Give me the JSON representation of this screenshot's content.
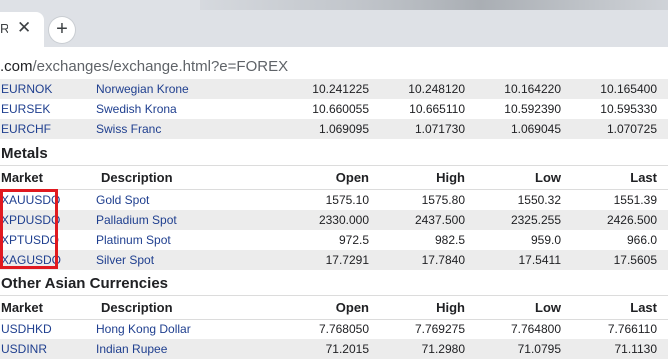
{
  "browser": {
    "tab_title": "R",
    "close_glyph": "✕",
    "new_tab_glyph": "+",
    "url_host": ".com",
    "url_path": "/exchanges/exchange.html?e=FOREX"
  },
  "columns": {
    "market": "Market",
    "description": "Description",
    "open": "Open",
    "high": "High",
    "low": "Low",
    "last": "Last"
  },
  "forex_rows": [
    {
      "market": "EURNOK",
      "description": "Norwegian Krone",
      "open": "10.241225",
      "high": "10.248120",
      "low": "10.164220",
      "last": "10.165400"
    },
    {
      "market": "EURSEK",
      "description": "Swedish Krona",
      "open": "10.660055",
      "high": "10.665110",
      "low": "10.592390",
      "last": "10.595330"
    },
    {
      "market": "EURCHF",
      "description": "Swiss Franc",
      "open": "1.069095",
      "high": "1.071730",
      "low": "1.069045",
      "last": "1.070725"
    }
  ],
  "metals": {
    "title": "Metals",
    "rows": [
      {
        "market": "XAUUSDO",
        "description": "Gold Spot",
        "open": "1575.10",
        "high": "1575.80",
        "low": "1550.32",
        "last": "1551.39"
      },
      {
        "market": "XPDUSDO",
        "description": "Palladium Spot",
        "open": "2330.000",
        "high": "2437.500",
        "low": "2325.255",
        "last": "2426.500"
      },
      {
        "market": "XPTUSDO",
        "description": "Platinum Spot",
        "open": "972.5",
        "high": "982.5",
        "low": "959.0",
        "last": "966.0"
      },
      {
        "market": "XAGUSDO",
        "description": "Silver Spot",
        "open": "17.7291",
        "high": "17.7840",
        "low": "17.5411",
        "last": "17.5605"
      }
    ]
  },
  "asian": {
    "title": "Other Asian Currencies",
    "rows": [
      {
        "market": "USDHKD",
        "description": "Hong Kong Dollar",
        "open": "7.768050",
        "high": "7.769275",
        "low": "7.764800",
        "last": "7.766110"
      },
      {
        "market": "USDINR",
        "description": "Indian Rupee",
        "open": "71.2015",
        "high": "71.2980",
        "low": "71.0795",
        "last": "71.1130"
      }
    ]
  },
  "colors": {
    "link": "#1f3f8f",
    "highlight_box": "#e0191f",
    "row_shade": "#ececec"
  }
}
